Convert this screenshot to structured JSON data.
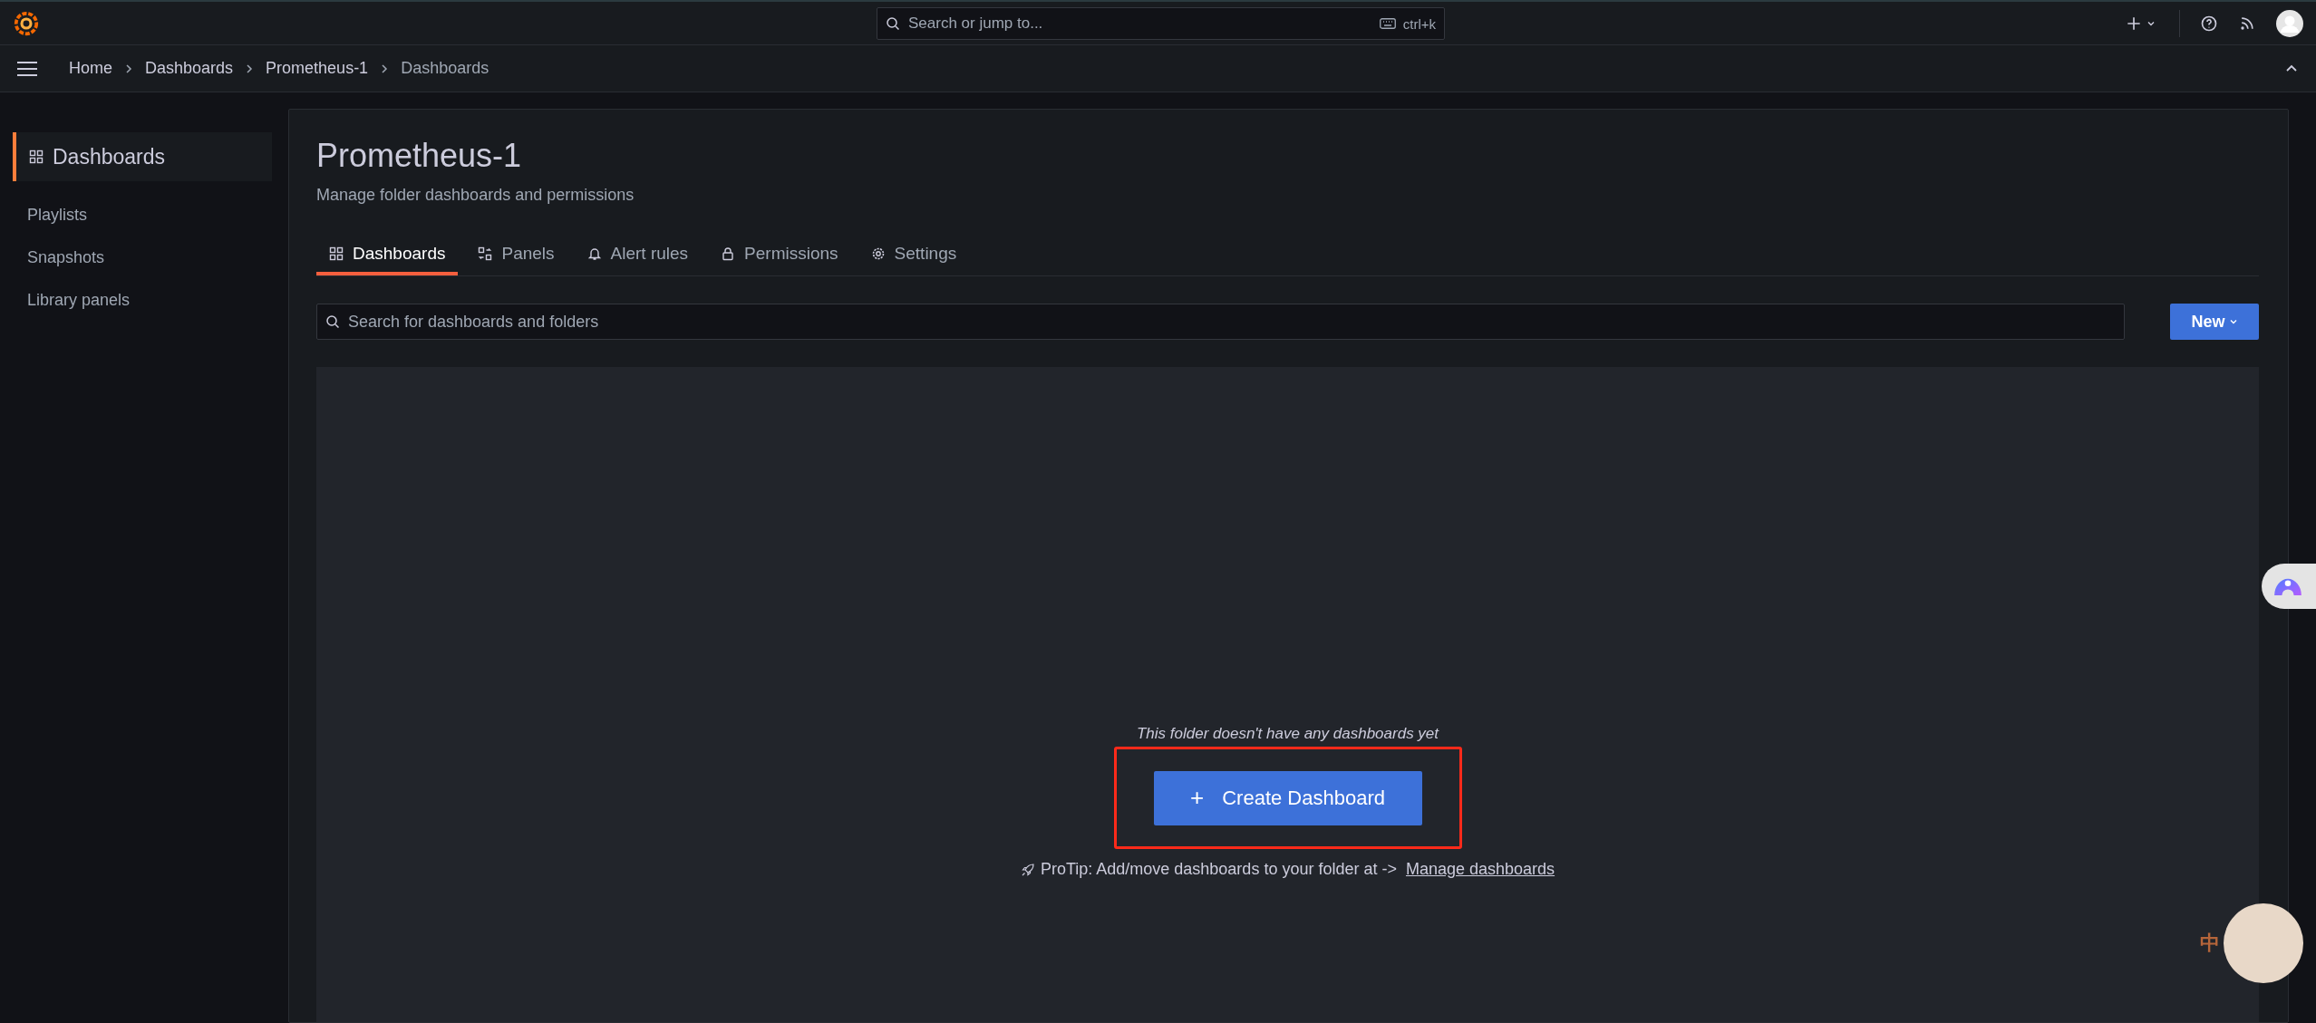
{
  "topbar": {
    "search": {
      "placeholder": "Search or jump to...",
      "shortcut": "ctrl+k"
    }
  },
  "breadcrumbs": [
    {
      "label": "Home",
      "current": false
    },
    {
      "label": "Dashboards",
      "current": false
    },
    {
      "label": "Prometheus-1",
      "current": false
    },
    {
      "label": "Dashboards",
      "current": true
    }
  ],
  "sidebar": {
    "items": [
      {
        "label": "Dashboards",
        "kind": "header",
        "selected": true
      },
      {
        "label": "Playlists",
        "kind": "link",
        "selected": false
      },
      {
        "label": "Snapshots",
        "kind": "link",
        "selected": false
      },
      {
        "label": "Library panels",
        "kind": "link",
        "selected": false
      }
    ]
  },
  "page": {
    "title": "Prometheus-1",
    "subtitle": "Manage folder dashboards and permissions",
    "tabs": [
      {
        "label": "Dashboards",
        "selected": true
      },
      {
        "label": "Panels",
        "selected": false
      },
      {
        "label": "Alert rules",
        "selected": false
      },
      {
        "label": "Permissions",
        "selected": false
      },
      {
        "label": "Settings",
        "selected": false
      }
    ],
    "search": {
      "placeholder": "Search for dashboards and folders"
    },
    "new_button": "New",
    "empty_state": {
      "message": "This folder doesn't have any dashboards yet",
      "create_button": "Create Dashboard",
      "create_icon": "+",
      "protip": "ProTip: Add/move dashboards to your folder at ->",
      "protip_link": "Manage dashboards"
    }
  },
  "mascot": {
    "badge": "中"
  }
}
